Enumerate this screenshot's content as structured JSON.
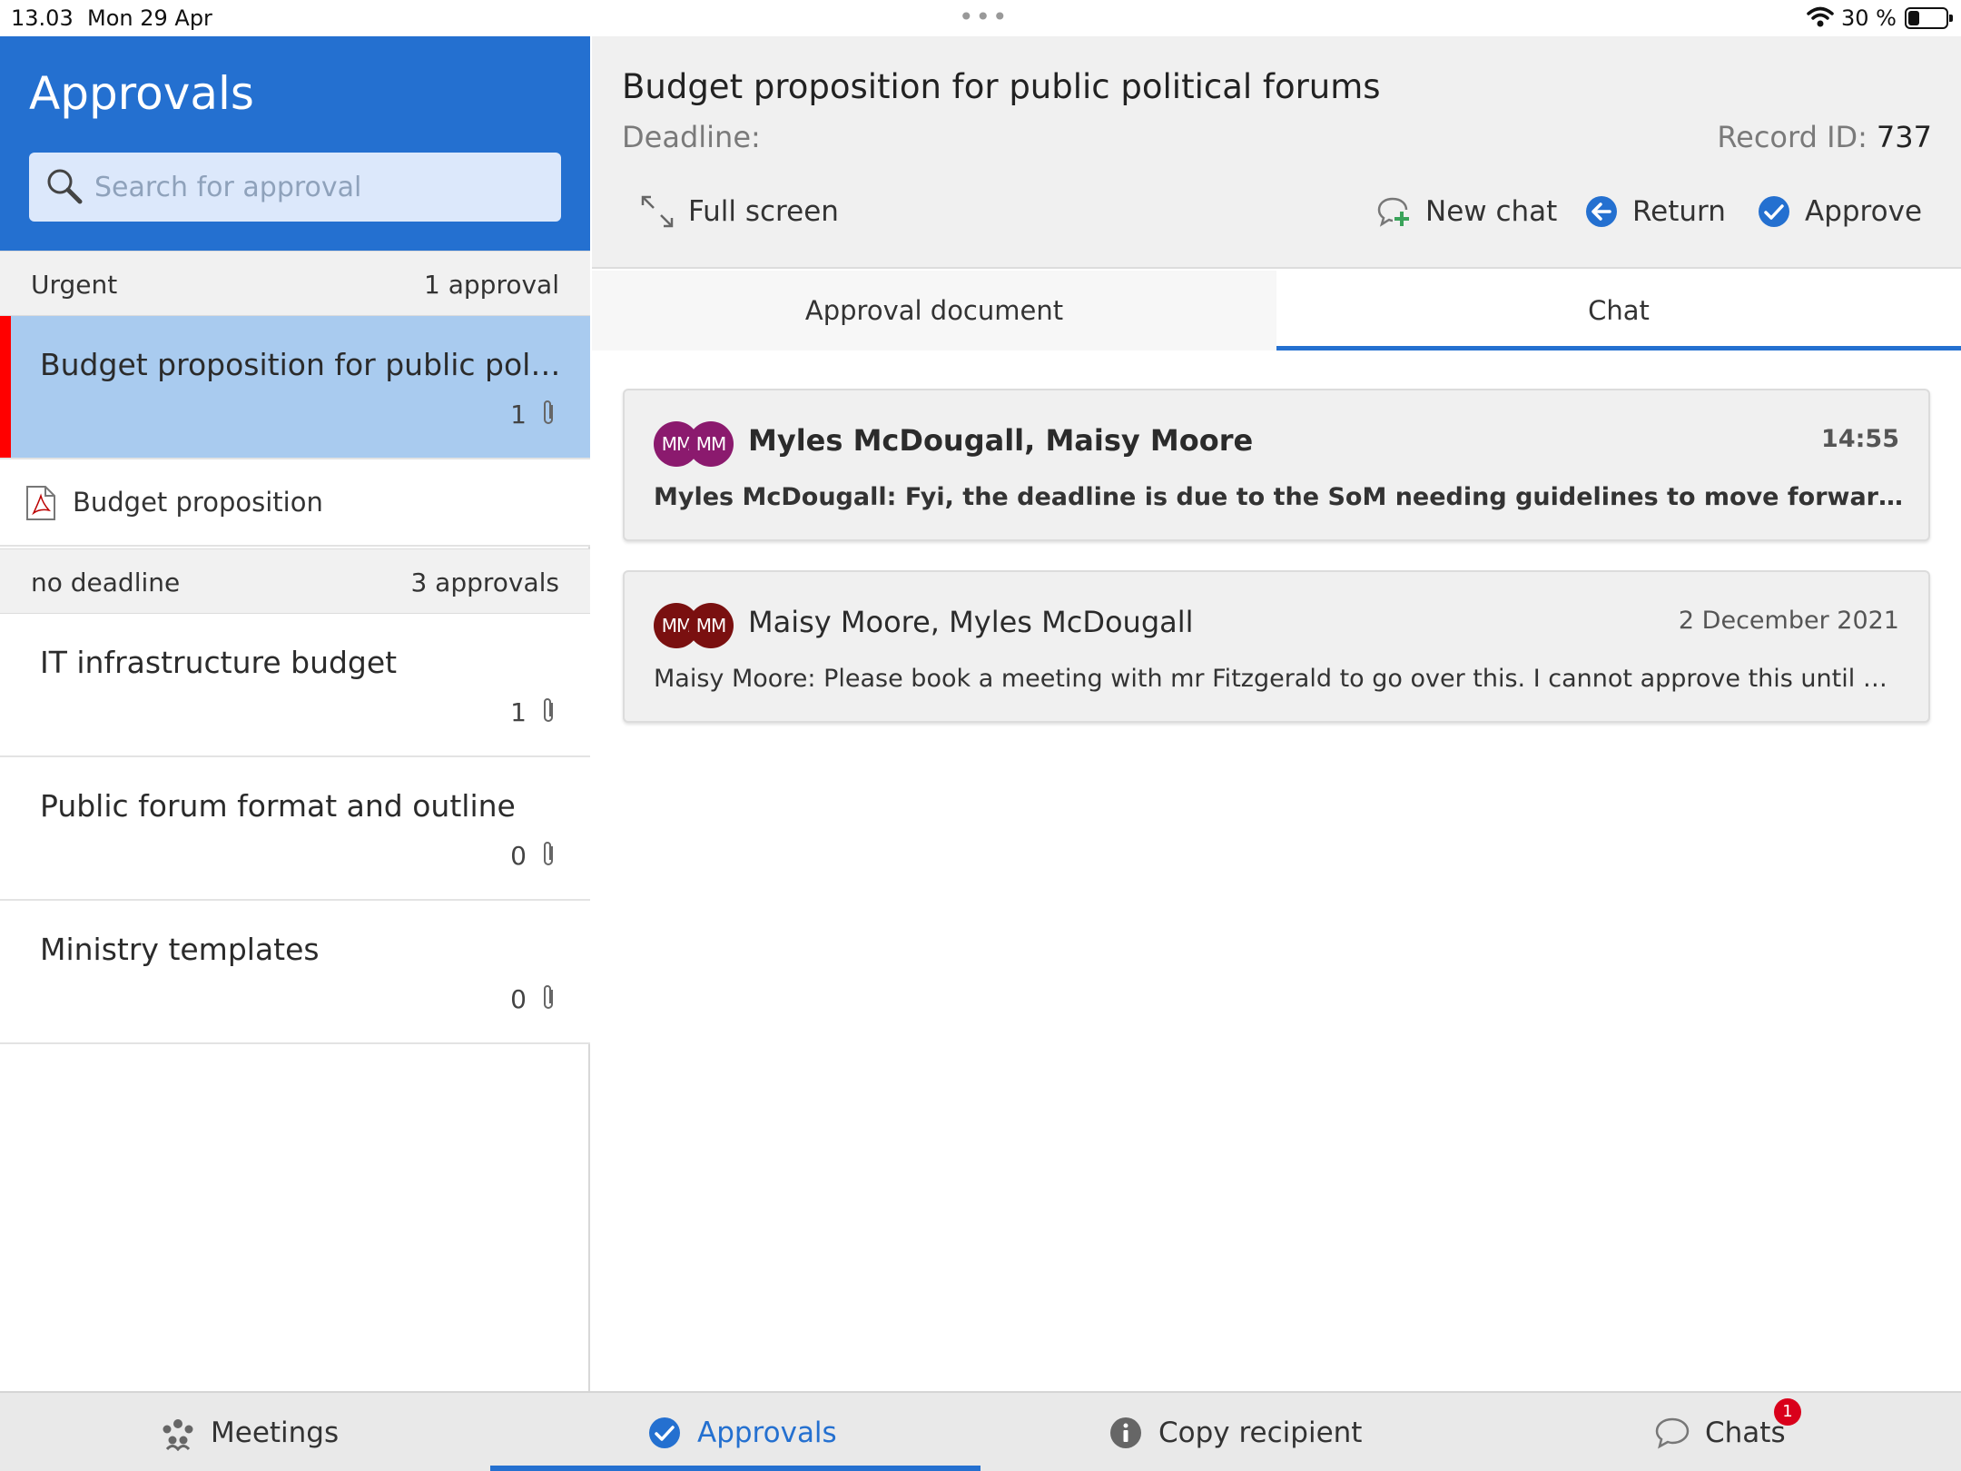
{
  "status_bar": {
    "time": "13.03",
    "date": "Mon 29 Apr",
    "battery_percent": "30 %",
    "battery_level": 0.3
  },
  "sidebar": {
    "title": "Approvals",
    "search_placeholder": "Search for approval",
    "groups": [
      {
        "title": "Urgent",
        "count": "1 approval",
        "items": [
          {
            "title": "Budget proposition for public political forums",
            "attachments": "1",
            "selected": true
          }
        ],
        "documents": [
          {
            "label": "Budget proposition"
          }
        ]
      },
      {
        "title": "no deadline",
        "count": "3 approvals",
        "items": [
          {
            "title": "IT infrastructure budget",
            "attachments": "1"
          },
          {
            "title": "Public forum format and outline",
            "attachments": "0"
          },
          {
            "title": "Ministry templates",
            "attachments": "0"
          }
        ]
      }
    ]
  },
  "detail": {
    "title": "Budget proposition for public political forums",
    "deadline_label": "Deadline:",
    "record_id_label": "Record ID:",
    "record_id": "737",
    "toolbar": {
      "full_screen": "Full screen",
      "new_chat": "New chat",
      "return": "Return",
      "approve": "Approve"
    },
    "tabs": [
      {
        "label": "Approval document",
        "active": false
      },
      {
        "label": "Chat",
        "active": true
      }
    ],
    "chats": [
      {
        "avatars": [
          {
            "initials": "MM",
            "color": "#8b1a6e"
          },
          {
            "initials": "MM",
            "color": "#8b1a6e"
          }
        ],
        "participants": "Myles McDougall, Maisy Moore",
        "time": "14:55",
        "preview": "Myles McDougall: Fyi, the deadline is due to the SoM needing guidelines to move forward with preparations for the forums",
        "unread": true
      },
      {
        "avatars": [
          {
            "initials": "MM",
            "color": "#7a1010"
          },
          {
            "initials": "MM",
            "color": "#7a1010"
          }
        ],
        "participants": "Maisy Moore, Myles McDougall",
        "time": "2 December 2021",
        "preview": "Maisy Moore: Please book a meeting with mr Fitzgerald to go over this. I cannot approve this until we have discussed it",
        "unread": false
      }
    ]
  },
  "bottom_nav": {
    "items": [
      {
        "label": "Meetings",
        "icon": "people-icon",
        "active": false
      },
      {
        "label": "Approvals",
        "icon": "check-circle-icon",
        "active": true
      },
      {
        "label": "Copy recipient",
        "icon": "info-icon",
        "active": false
      },
      {
        "label": "Chats",
        "icon": "chat-bubble-icon",
        "active": false,
        "badge": "1"
      }
    ]
  },
  "colors": {
    "brand_blue": "#2470d0",
    "urgent_red": "#ff0000",
    "selected_row": "#a9cbef",
    "badge_red": "#d9001b"
  }
}
